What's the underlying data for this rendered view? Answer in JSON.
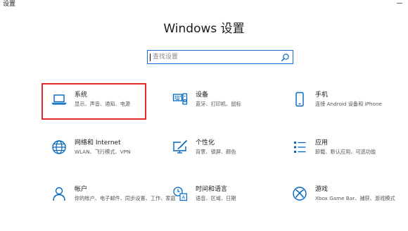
{
  "window": {
    "title": "设置"
  },
  "header": {
    "title": "Windows 设置"
  },
  "search": {
    "placeholder": "查找设置",
    "value": ""
  },
  "tiles": [
    {
      "id": "system",
      "title": "系统",
      "desc": "显示、声音、通知、电源",
      "icon": "laptop-icon",
      "selected": true
    },
    {
      "id": "devices",
      "title": "设备",
      "desc": "蓝牙、打印机、鼠标",
      "icon": "keyboard-speaker-icon",
      "selected": false
    },
    {
      "id": "phone",
      "title": "手机",
      "desc": "连接 Android 设备和 iPhone",
      "icon": "phone-icon",
      "selected": false
    },
    {
      "id": "network",
      "title": "网络和 Internet",
      "desc": "WLAN、飞行模式、VPN",
      "icon": "globe-icon",
      "selected": false
    },
    {
      "id": "personalization",
      "title": "个性化",
      "desc": "背景、锁屏、颜色",
      "icon": "paint-monitor-icon",
      "selected": false
    },
    {
      "id": "apps",
      "title": "应用",
      "desc": "卸载、默认应用、可选功能",
      "icon": "app-list-icon",
      "selected": false
    },
    {
      "id": "accounts",
      "title": "帐户",
      "desc": "你的帐户、电子邮件、同步设置、工作、家庭",
      "icon": "person-icon",
      "selected": false
    },
    {
      "id": "time-language",
      "title": "时间和语言",
      "desc": "语音、区域、日期",
      "icon": "clock-language-icon",
      "selected": false
    },
    {
      "id": "gaming",
      "title": "游戏",
      "desc": "Xbox Game Bar、捕获、游戏模式",
      "icon": "xbox-icon",
      "selected": false
    }
  ],
  "colors": {
    "accent": "#0067c0",
    "selection": "#e4282b",
    "search_border": "#1a6fd1"
  }
}
